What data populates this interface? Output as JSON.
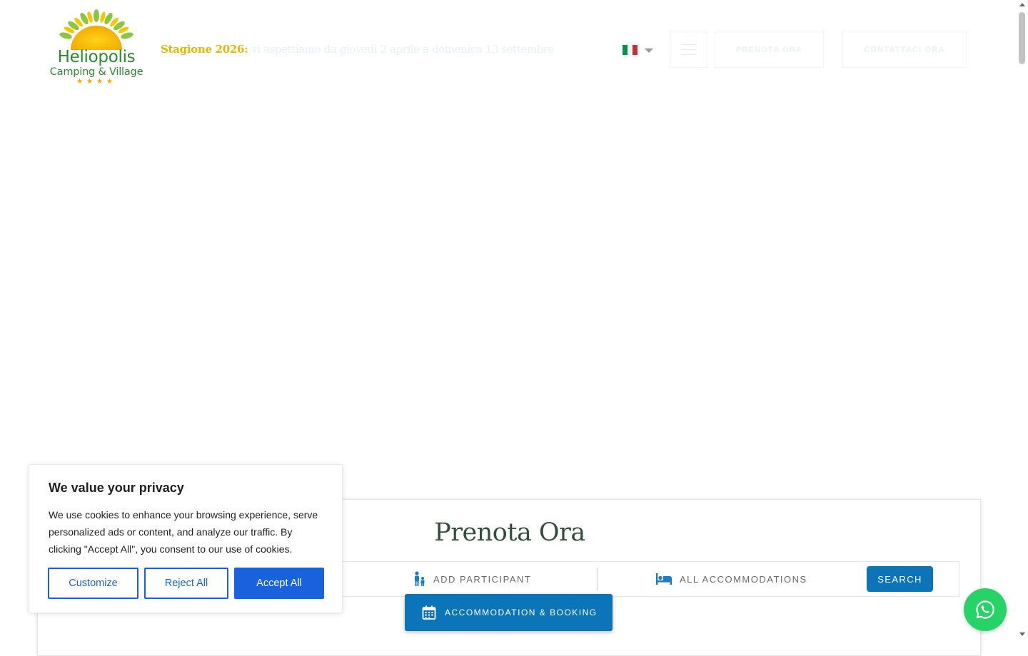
{
  "header": {
    "logo": {
      "title": "Heliopolis",
      "subtitle": "Camping & Village",
      "stars": "★★★★"
    },
    "season": {
      "label": "Stagione 2026:",
      "text": "vi aspettiamo da giovedì 2 aprile a domenica 13 settembre"
    },
    "language": {
      "selected": "Italiano",
      "icon": "italy-flag-icon"
    },
    "menu_icon": "hamburger-menu-icon",
    "book_button": "PRENOTA ORA",
    "contact_button": "CONTATTACI ORA"
  },
  "booking": {
    "title": "Prenota Ora",
    "participants": {
      "icon": "family-icon",
      "label": "ADD PARTICIPANT"
    },
    "accommodation": {
      "icon": "bed-icon",
      "label": "ALL ACCOMMODATIONS"
    },
    "search_button": "SEARCH",
    "tab": {
      "icon": "calendar-icon",
      "label": "ACCOMMODATION & BOOKING"
    }
  },
  "cookie_banner": {
    "title": "We value your privacy",
    "text": "We use cookies to enhance your browsing experience, serve personalized ads or content, and analyze our traffic. By clicking \"Accept All\", you consent to our use of cookies.",
    "customize": "Customize",
    "reject": "Reject All",
    "accept": "Accept All"
  },
  "whatsapp": {
    "icon": "whatsapp-icon"
  },
  "colors": {
    "brand_green": "#2c8a2c",
    "brand_yellow": "#e6b800",
    "primary_blue": "#0c74b9",
    "cookie_blue": "#1863dc",
    "whatsapp_green": "#25d366",
    "title_green": "#2f4f3a"
  }
}
